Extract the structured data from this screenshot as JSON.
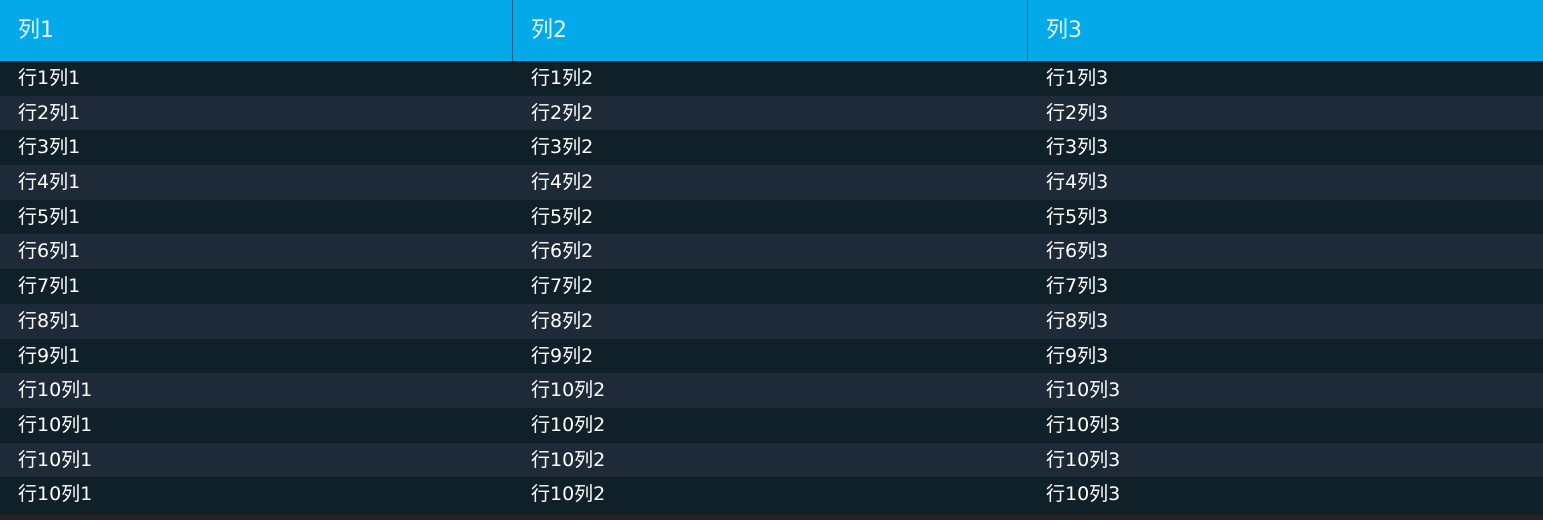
{
  "table": {
    "headers": [
      "列1",
      "列2",
      "列3"
    ],
    "rows": [
      [
        "行1列1",
        "行1列2",
        "行1列3"
      ],
      [
        "行2列1",
        "行2列2",
        "行2列3"
      ],
      [
        "行3列1",
        "行3列2",
        "行3列3"
      ],
      [
        "行4列1",
        "行4列2",
        "行4列3"
      ],
      [
        "行5列1",
        "行5列2",
        "行5列3"
      ],
      [
        "行6列1",
        "行6列2",
        "行6列3"
      ],
      [
        "行7列1",
        "行7列2",
        "行7列3"
      ],
      [
        "行8列1",
        "行8列2",
        "行8列3"
      ],
      [
        "行9列1",
        "行9列2",
        "行9列3"
      ],
      [
        "行10列1",
        "行10列2",
        "行10列3"
      ],
      [
        "行10列1",
        "行10列2",
        "行10列3"
      ],
      [
        "行10列1",
        "行10列2",
        "行10列3"
      ],
      [
        "行10列1",
        "行10列2",
        "行10列3"
      ]
    ]
  },
  "colors": {
    "header_bg": "#03a9e9",
    "row_odd_bg": "#0f2029",
    "row_even_bg": "#1f2a38",
    "text": "#ffffff"
  }
}
